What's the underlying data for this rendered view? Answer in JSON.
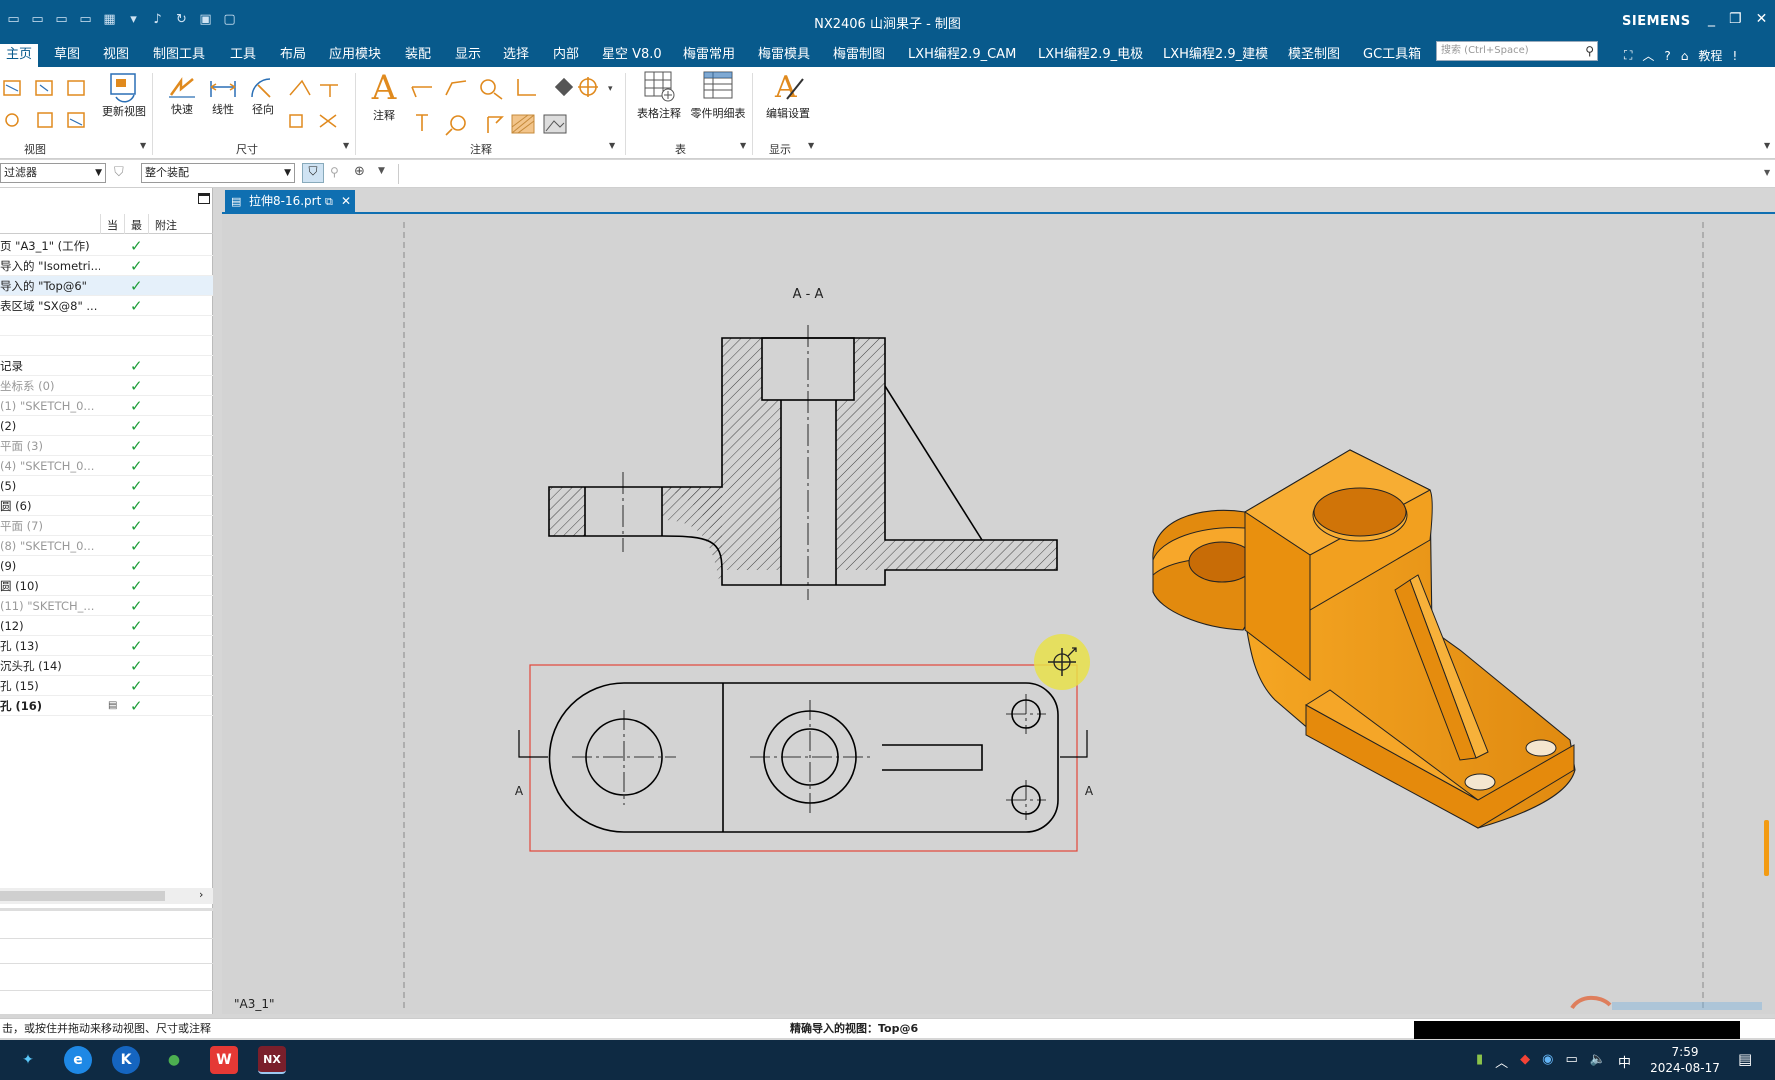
{
  "window": {
    "title": "NX2406 山涧果子 - 制图",
    "brand": "SIEMENS"
  },
  "menu": {
    "tabs": [
      "主页",
      "草图",
      "视图",
      "制图工具",
      "工具",
      "布局",
      "应用模块",
      "装配",
      "显示",
      "选择",
      "内部",
      "星空 V8.0",
      "梅雷常用",
      "梅雷模具",
      "梅雷制图",
      "LXH编程2.9_CAM",
      "LXH编程2.9_电极",
      "LXH编程2.9_建模",
      "模圣制图",
      "GC工具箱"
    ],
    "search_placeholder": "搜索 (Ctrl+Space)",
    "help_label": "教程"
  },
  "ribbon": {
    "buttons": {
      "update_view": "更新视图",
      "rapid": "快速",
      "linear": "线性",
      "radial": "径向",
      "note": "注释",
      "tabular_note": "表格注释",
      "parts_list": "零件明细表",
      "edit_settings": "编辑设置"
    },
    "groups": {
      "view": "视图",
      "dimension": "尺寸",
      "annotation": "注释",
      "table": "表",
      "display": "显示"
    }
  },
  "toolbar2": {
    "filter": "过滤器",
    "scope": "整个装配"
  },
  "nav": {
    "headers": [
      "当",
      "最",
      "附注"
    ],
    "rows": [
      {
        "label": "页 \"A3_1\" (工作)",
        "style": "normal"
      },
      {
        "label": "导入的 \"Isometri...",
        "style": "normal"
      },
      {
        "label": "导入的 \"Top@6\"",
        "style": "normal",
        "selected": true
      },
      {
        "label": "表区域 \"SX@8\" ...",
        "style": "normal"
      },
      {
        "label": "",
        "style": "blank"
      },
      {
        "label": "",
        "style": "blank"
      },
      {
        "label": "记录",
        "style": "normal"
      },
      {
        "label": "坐标系 (0)",
        "style": "gray"
      },
      {
        "label": "(1) \"SKETCH_0...",
        "style": "gray"
      },
      {
        "label": "(2)",
        "style": "normal"
      },
      {
        "label": "平面 (3)",
        "style": "gray"
      },
      {
        "label": "(4) \"SKETCH_0...",
        "style": "gray"
      },
      {
        "label": "(5)",
        "style": "normal"
      },
      {
        "label": "圆 (6)",
        "style": "normal"
      },
      {
        "label": "平面 (7)",
        "style": "gray"
      },
      {
        "label": "(8) \"SKETCH_0...",
        "style": "gray"
      },
      {
        "label": "(9)",
        "style": "normal"
      },
      {
        "label": "圆 (10)",
        "style": "normal"
      },
      {
        "label": "(11) \"SKETCH_...",
        "style": "gray"
      },
      {
        "label": "(12)",
        "style": "normal"
      },
      {
        "label": "孔 (13)",
        "style": "normal"
      },
      {
        "label": "沉头孔 (14)",
        "style": "normal"
      },
      {
        "label": "孔 (15)",
        "style": "normal"
      },
      {
        "label": "孔 (16)",
        "style": "bold"
      }
    ]
  },
  "doc": {
    "tab": "拉伸8-16.prt",
    "sheet": "\"A3_1\""
  },
  "drawing": {
    "section_title": "A - A",
    "section_mark": "A"
  },
  "status": {
    "hint": "击，或按住并拖动来移动视图、尺寸或注释",
    "message": "精确导入的视图：Top@6"
  },
  "taskbar": {
    "time": "7:59",
    "date": "2024-08-17",
    "ime": "中"
  },
  "colors": {
    "accent": "#085a8c",
    "tab_blue": "#0f6fb1",
    "model_orange": "#f39b12",
    "check_green": "#1e9e3a"
  }
}
